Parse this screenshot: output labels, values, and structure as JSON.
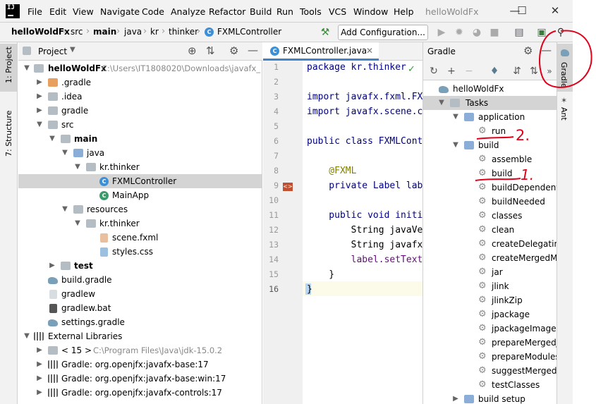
{
  "menubar": {
    "items": [
      "File",
      "Edit",
      "View",
      "Navigate",
      "Code",
      "Analyze",
      "Refactor",
      "Build",
      "Run",
      "Tools",
      "VCS",
      "Window",
      "Help"
    ],
    "window_title": "helloWoldFx"
  },
  "navbar": {
    "crumbs": [
      "helloWoldFx",
      "src",
      "main",
      "java",
      "kr",
      "thinker",
      "FXMLController"
    ],
    "add_configuration": "Add Configuration..."
  },
  "left_stripe": {
    "project_tab": "1: Project",
    "structure_tab": "7: Structure"
  },
  "project": {
    "title": "Project",
    "rows": [
      {
        "label": "helloWoldFx",
        "path": "C:\\Users\\IT1808020\\Downloads\\javafx_",
        "icon": "folder-icon"
      },
      {
        "label": ".gradle",
        "icon": "folder-icon"
      },
      {
        "label": ".idea",
        "icon": "folder-icon"
      },
      {
        "label": "gradle",
        "icon": "folder-icon"
      },
      {
        "label": "src",
        "icon": "folder-icon"
      },
      {
        "label": "main",
        "icon": "folder-icon"
      },
      {
        "label": "java",
        "icon": "folder-icon"
      },
      {
        "label": "kr.thinker",
        "icon": "package-icon"
      },
      {
        "label": "FXMLController",
        "icon": "class-icon"
      },
      {
        "label": "MainApp",
        "icon": "class-icon"
      },
      {
        "label": "resources",
        "icon": "folder-icon"
      },
      {
        "label": "kr.thinker",
        "icon": "package-icon"
      },
      {
        "label": "scene.fxml",
        "icon": "fxml-file-icon"
      },
      {
        "label": "styles.css",
        "icon": "css-file-icon"
      },
      {
        "label": "test",
        "icon": "folder-icon"
      },
      {
        "label": "build.gradle",
        "icon": "gradle-file-icon"
      },
      {
        "label": "gradlew",
        "icon": "file-icon"
      },
      {
        "label": "gradlew.bat",
        "icon": "file-icon"
      },
      {
        "label": "settings.gradle",
        "icon": "gradle-file-icon"
      },
      {
        "label": "External Libraries",
        "icon": "library-icon"
      },
      {
        "label": "< 15 >",
        "path": "C:\\Program Files\\Java\\jdk-15.0.2",
        "icon": "jdk-icon"
      },
      {
        "label": "Gradle: org.openjfx:javafx-base:17",
        "icon": "library-icon"
      },
      {
        "label": "Gradle: org.openjfx:javafx-base:win:17",
        "icon": "library-icon"
      },
      {
        "label": "Gradle: org.openjfx:javafx-controls:17",
        "icon": "library-icon"
      }
    ]
  },
  "editor": {
    "tab_label": "FXMLController.java",
    "lines": [
      {
        "n": "1",
        "text": "package kr.thinker"
      },
      {
        "n": "2",
        "text": ""
      },
      {
        "n": "3",
        "text": "import javafx.fxml.FX"
      },
      {
        "n": "4",
        "text": "import javafx.scene.c"
      },
      {
        "n": "5",
        "text": ""
      },
      {
        "n": "6",
        "text": "public class FXMLCont"
      },
      {
        "n": "7",
        "text": ""
      },
      {
        "n": "8",
        "text": "    @FXML"
      },
      {
        "n": "9",
        "text": "    private Label lab"
      },
      {
        "n": "10",
        "text": ""
      },
      {
        "n": "11",
        "text": "    public void initi"
      },
      {
        "n": "12",
        "text": "        String javaVe"
      },
      {
        "n": "13",
        "text": "        String javafx"
      },
      {
        "n": "14",
        "text": "        label.setText"
      },
      {
        "n": "15",
        "text": "    }"
      },
      {
        "n": "16",
        "text": "}"
      }
    ]
  },
  "gradle": {
    "title": "Gradle",
    "rows": [
      {
        "label": "helloWoldFx",
        "kind": "project"
      },
      {
        "label": "Tasks",
        "kind": "folder"
      },
      {
        "label": "application",
        "kind": "group"
      },
      {
        "label": "run",
        "kind": "task"
      },
      {
        "label": "build",
        "kind": "group"
      },
      {
        "label": "assemble",
        "kind": "task"
      },
      {
        "label": "build",
        "kind": "task"
      },
      {
        "label": "buildDependents",
        "kind": "task"
      },
      {
        "label": "buildNeeded",
        "kind": "task"
      },
      {
        "label": "classes",
        "kind": "task"
      },
      {
        "label": "clean",
        "kind": "task"
      },
      {
        "label": "createDelegatingI",
        "kind": "task"
      },
      {
        "label": "createMergedMo",
        "kind": "task"
      },
      {
        "label": "jar",
        "kind": "task"
      },
      {
        "label": "jlink",
        "kind": "task"
      },
      {
        "label": "jlinkZip",
        "kind": "task"
      },
      {
        "label": "jpackage",
        "kind": "task"
      },
      {
        "label": "jpackageImage",
        "kind": "task"
      },
      {
        "label": "prepareMergedJa",
        "kind": "task"
      },
      {
        "label": "prepareModulesD",
        "kind": "task"
      },
      {
        "label": "suggestMergedM",
        "kind": "task"
      },
      {
        "label": "testClasses",
        "kind": "task"
      },
      {
        "label": "build setup",
        "kind": "group"
      }
    ]
  },
  "right_stripe": {
    "gradle_tab": "Gradle",
    "ant_tab": "Ant"
  },
  "annotations": {
    "mark_run": "2.",
    "mark_build": "1."
  },
  "colors": {
    "selection": "#d4d4d4",
    "accent": "#4083c9",
    "annotation_red": "#e0001a",
    "keyword": "#000080",
    "annotation_color": "#808000"
  }
}
